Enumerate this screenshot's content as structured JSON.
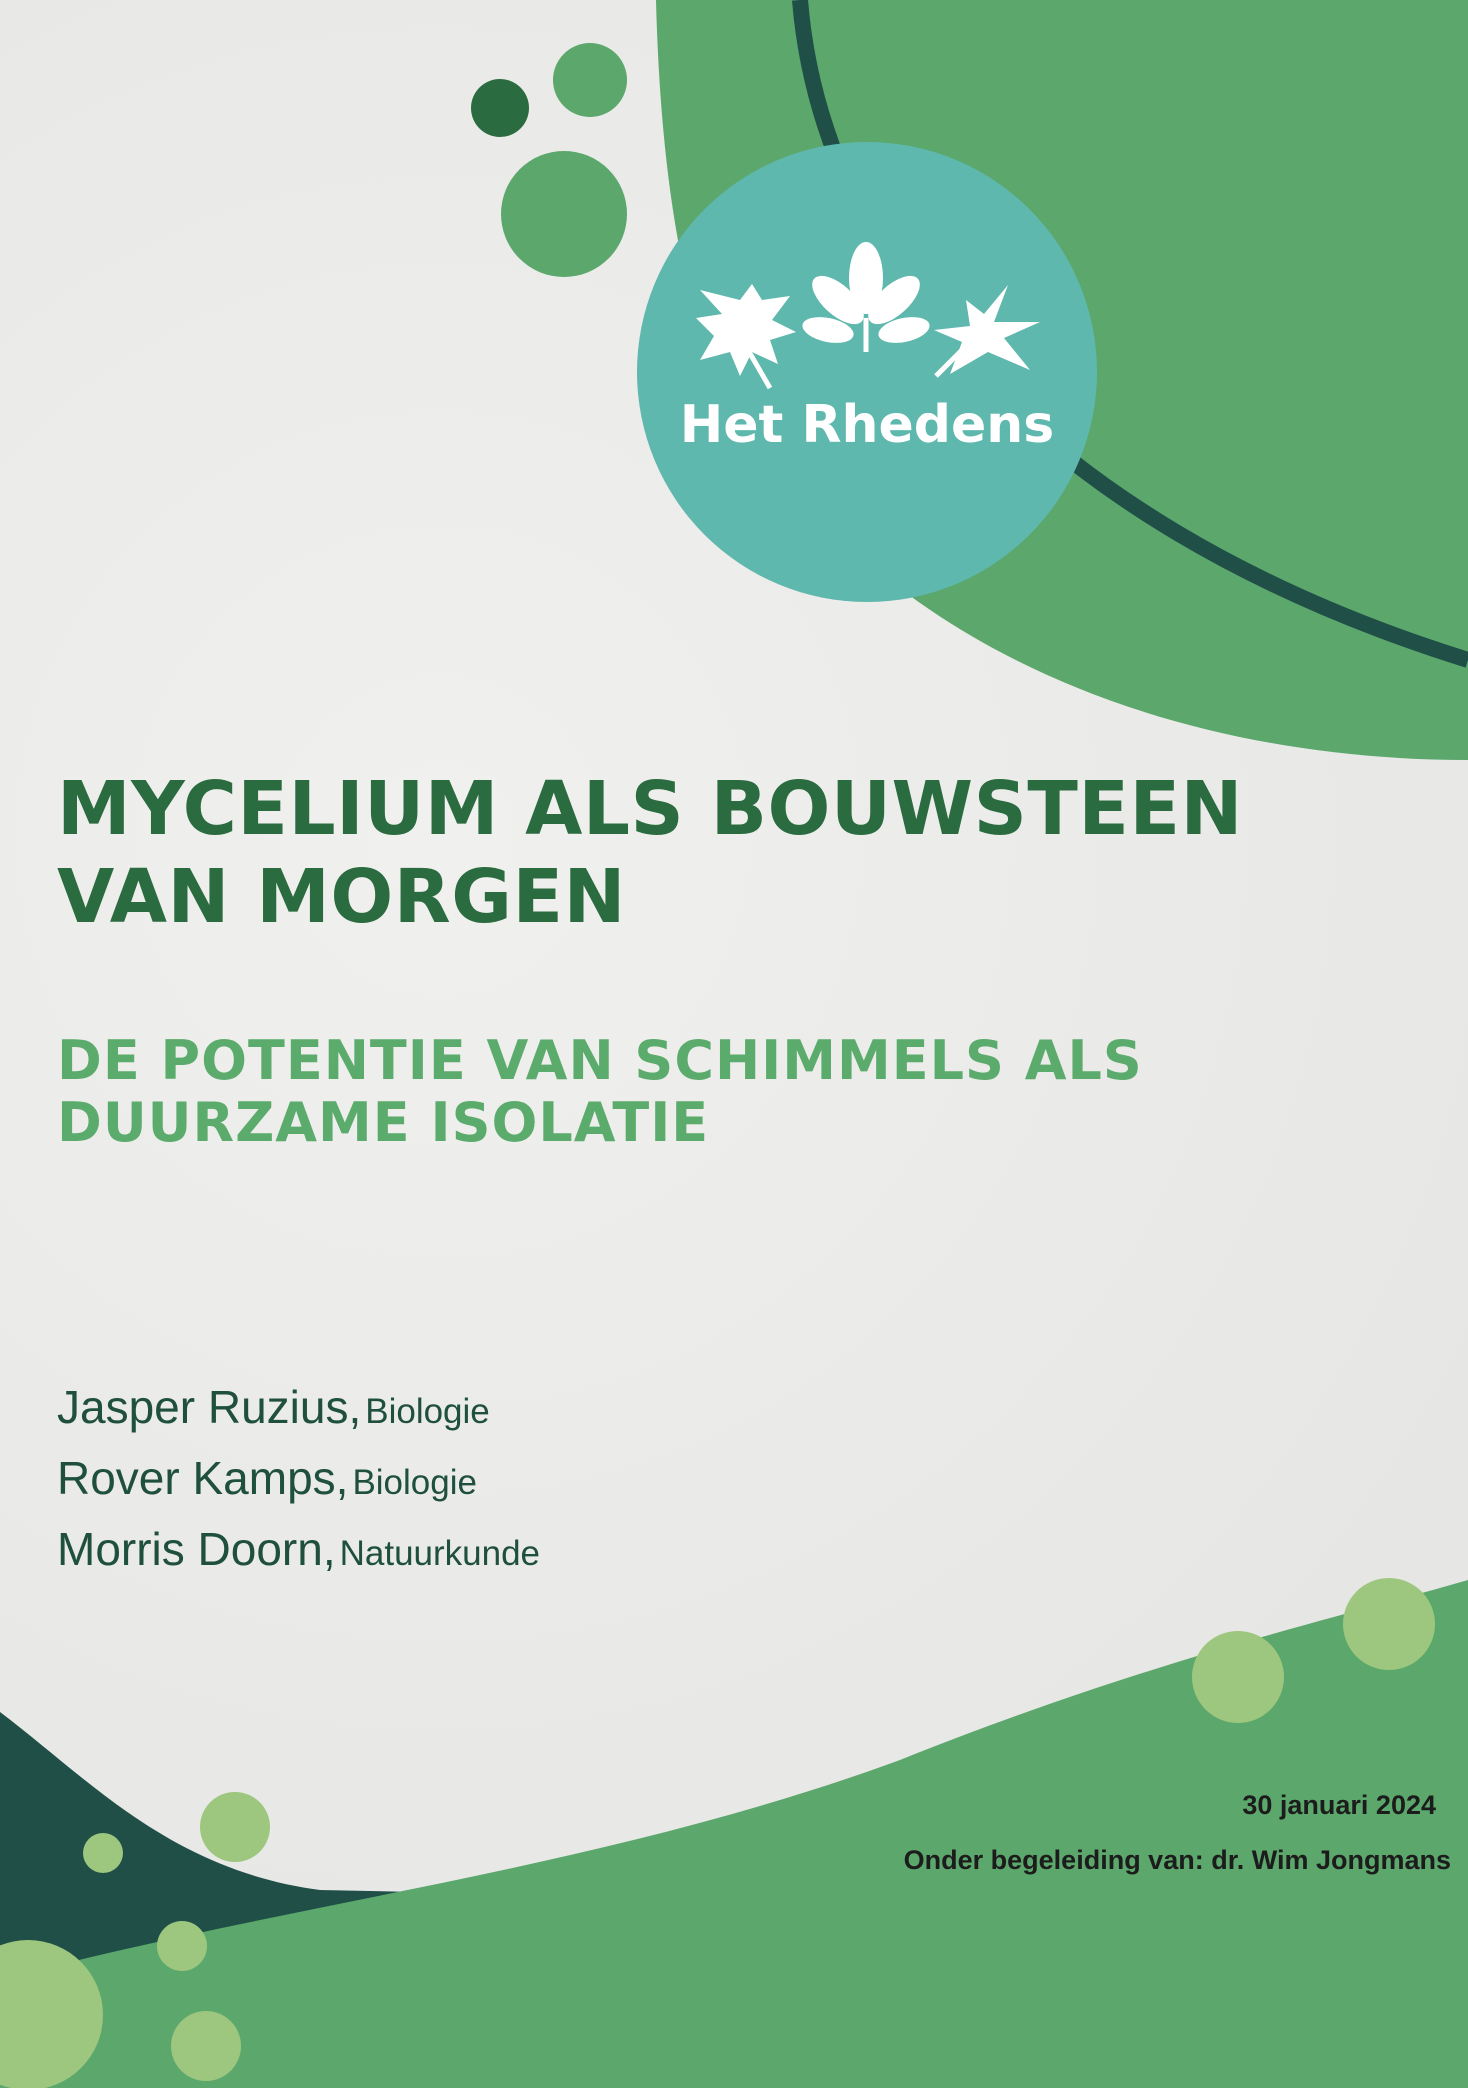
{
  "document": {
    "title": "MYCELIUM ALS BOUWSTEEN\nVAN MORGEN",
    "subtitle": "DE POTENTIE VAN SCHIMMELS ALS\nDUURZAME ISOLATIE",
    "authors": [
      {
        "name": "Jasper Ruzius,",
        "field": "Biologie"
      },
      {
        "name": "Rover Kamps,",
        "field": "Biologie"
      },
      {
        "name": "Morris Doorn,",
        "field": "Natuurkunde"
      }
    ],
    "date": "30 januari 2024",
    "supervisor": "Onder begeleiding van: dr. Wim Jongmans"
  },
  "logo": {
    "wordmark": "Het Rhedens",
    "icon": "three-leaves-icon"
  },
  "colors": {
    "primary_green": "#5ba76c",
    "dark_green": "#2a6b3f",
    "deep_teal": "#1f4f47",
    "logo_teal": "#5fb8ad",
    "light_green": "#9dc77e",
    "subtitle_green": "#5bab6c"
  }
}
